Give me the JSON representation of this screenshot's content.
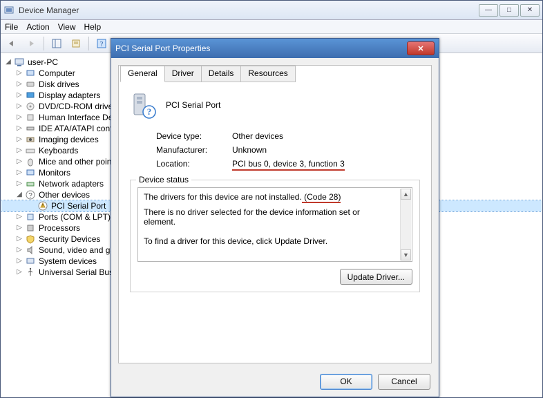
{
  "main": {
    "title": "Device Manager",
    "menus": [
      "File",
      "Action",
      "View",
      "Help"
    ]
  },
  "tree": {
    "root": "user-PC",
    "items": [
      "Computer",
      "Disk drives",
      "Display adapters",
      "DVD/CD-ROM drives",
      "Human Interface Devices",
      "IDE ATA/ATAPI controllers",
      "Imaging devices",
      "Keyboards",
      "Mice and other pointing devices",
      "Monitors",
      "Network adapters"
    ],
    "other_devices_label": "Other devices",
    "other_devices_child": "PCI Serial Port",
    "items_after": [
      "Ports (COM & LPT)",
      "Processors",
      "Security Devices",
      "Sound, video and game controllers",
      "System devices",
      "Universal Serial Bus controllers"
    ]
  },
  "dialog": {
    "title": "PCI Serial Port Properties",
    "tabs": [
      "General",
      "Driver",
      "Details",
      "Resources"
    ],
    "device_name": "PCI Serial Port",
    "rows": {
      "type_label": "Device type:",
      "type_value": "Other devices",
      "mfr_label": "Manufacturer:",
      "mfr_value": "Unknown",
      "loc_label": "Location:",
      "loc_value": "PCI bus 0, device 3, function 3"
    },
    "status_legend": "Device status",
    "status_line1a": "The drivers for this device are not installed.",
    "status_line1b": " (Code 28)",
    "status_line2": "There is no driver selected for the device information set or element.",
    "status_line3": "To find a driver for this device, click Update Driver.",
    "update_btn": "Update Driver...",
    "ok": "OK",
    "cancel": "Cancel"
  }
}
